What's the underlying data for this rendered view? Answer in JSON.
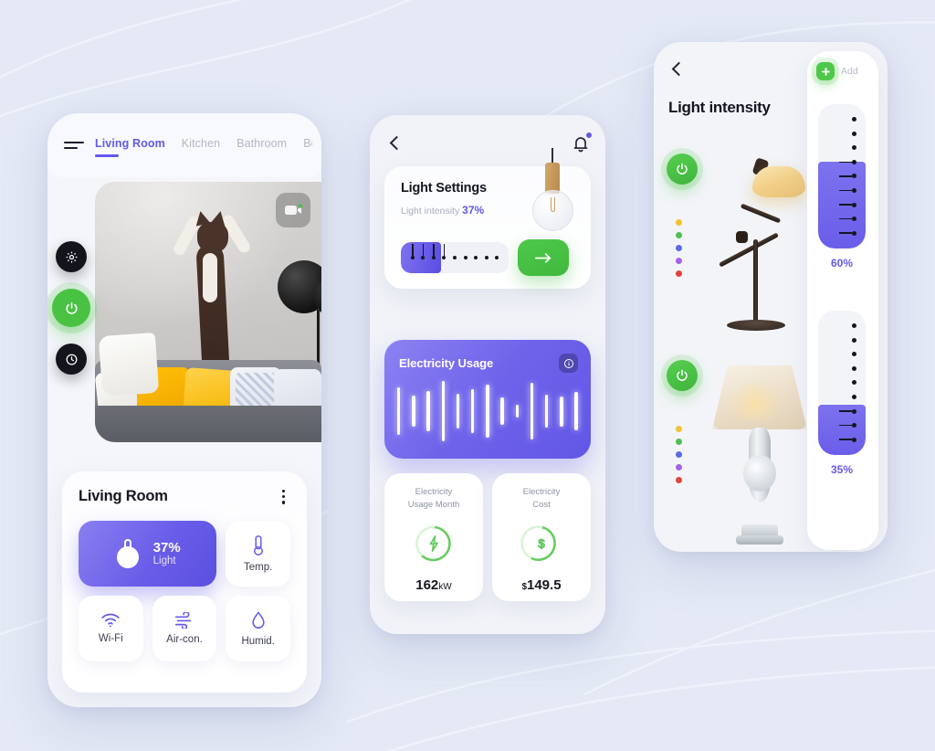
{
  "theme": {
    "page_bg": "#e4e9f5",
    "accent_purple": "#6359e9",
    "accent_green": "#4ec84a",
    "text_dark": "#15161f",
    "text_muted": "#a9aebd"
  },
  "phone_living": {
    "menu_icon": "hamburger-icon",
    "tabs": [
      {
        "label": "Living Room",
        "active": true
      },
      {
        "label": "Kitchen",
        "active": false
      },
      {
        "label": "Bathroom",
        "active": false
      },
      {
        "label": "Be",
        "active": false
      }
    ],
    "viewport": {
      "camera_icon": "video-camera-icon",
      "scene": "living room camera feed with cat"
    },
    "side_buttons": [
      {
        "icon": "gear-icon",
        "style": "dark"
      },
      {
        "icon": "power-icon",
        "style": "green"
      },
      {
        "icon": "clock-icon",
        "style": "dark"
      }
    ],
    "card": {
      "title": "Living Room",
      "menu_icon": "more-vertical-icon",
      "tiles": [
        {
          "name": "light",
          "icon": "bulb-icon",
          "value": "37%",
          "label": "Light",
          "active": true
        },
        {
          "name": "temperature",
          "icon": "thermometer-icon",
          "label": "Temp.",
          "active": false
        },
        {
          "name": "wifi",
          "icon": "wifi-icon",
          "label": "Wi-Fi",
          "active": false
        },
        {
          "name": "air-conditioner",
          "icon": "wind-icon",
          "label": "Air-con.",
          "active": false
        },
        {
          "name": "humidity",
          "icon": "droplet-icon",
          "label": "Humid.",
          "active": false
        }
      ]
    }
  },
  "phone_light": {
    "back_icon": "chevron-left-icon",
    "bell_icon": "bell-icon",
    "has_notification": true,
    "light_settings": {
      "title": "Light Settings",
      "intensity_label": "Light intensity",
      "intensity_value": "37%",
      "slider_steps": 9,
      "slider_filled_steps": 4,
      "slider_fill_percent": 37,
      "submit_icon": "arrow-right-icon",
      "bulb_icon": "edison-bulb-image"
    },
    "electricity_usage": {
      "title": "Electricity Usage",
      "info_icon": "info-icon",
      "bars": [
        54,
        36,
        46,
        68,
        40,
        50,
        60,
        30,
        14,
        64,
        38,
        34,
        44
      ]
    },
    "stats": [
      {
        "label": "Electricity\nUsage Month",
        "label_line1": "Electricity",
        "label_line2": "Usage Month",
        "gauge_icon": "bolt-icon",
        "value": "162",
        "unit": "kW",
        "currency": "",
        "gauge_percent": 78
      },
      {
        "label": "Electricity\nCost",
        "label_line1": "Electricity",
        "label_line2": "Cost",
        "gauge_icon": "dollar-icon",
        "value": "149.5",
        "unit": "",
        "currency": "$",
        "gauge_percent": 70
      }
    ]
  },
  "phone_intensity": {
    "back_icon": "chevron-left-icon",
    "title": "Light intensity",
    "add_button": {
      "icon": "plus-icon",
      "label": "Add"
    },
    "color_swatches": [
      "#f2c230",
      "#4fbf52",
      "#5b6ae8",
      "#a662e8",
      "#e0443c"
    ],
    "lamps": [
      {
        "name": "desk-lamp",
        "power_icon": "power-icon",
        "power_on": true,
        "intensity": "60%",
        "intensity_percent": 60,
        "tick_count": 9,
        "ticks_on": 6
      },
      {
        "name": "table-lamp",
        "power_icon": "power-icon",
        "power_on": true,
        "intensity": "35%",
        "intensity_percent": 35,
        "tick_count": 9,
        "ticks_on": 3
      }
    ]
  }
}
